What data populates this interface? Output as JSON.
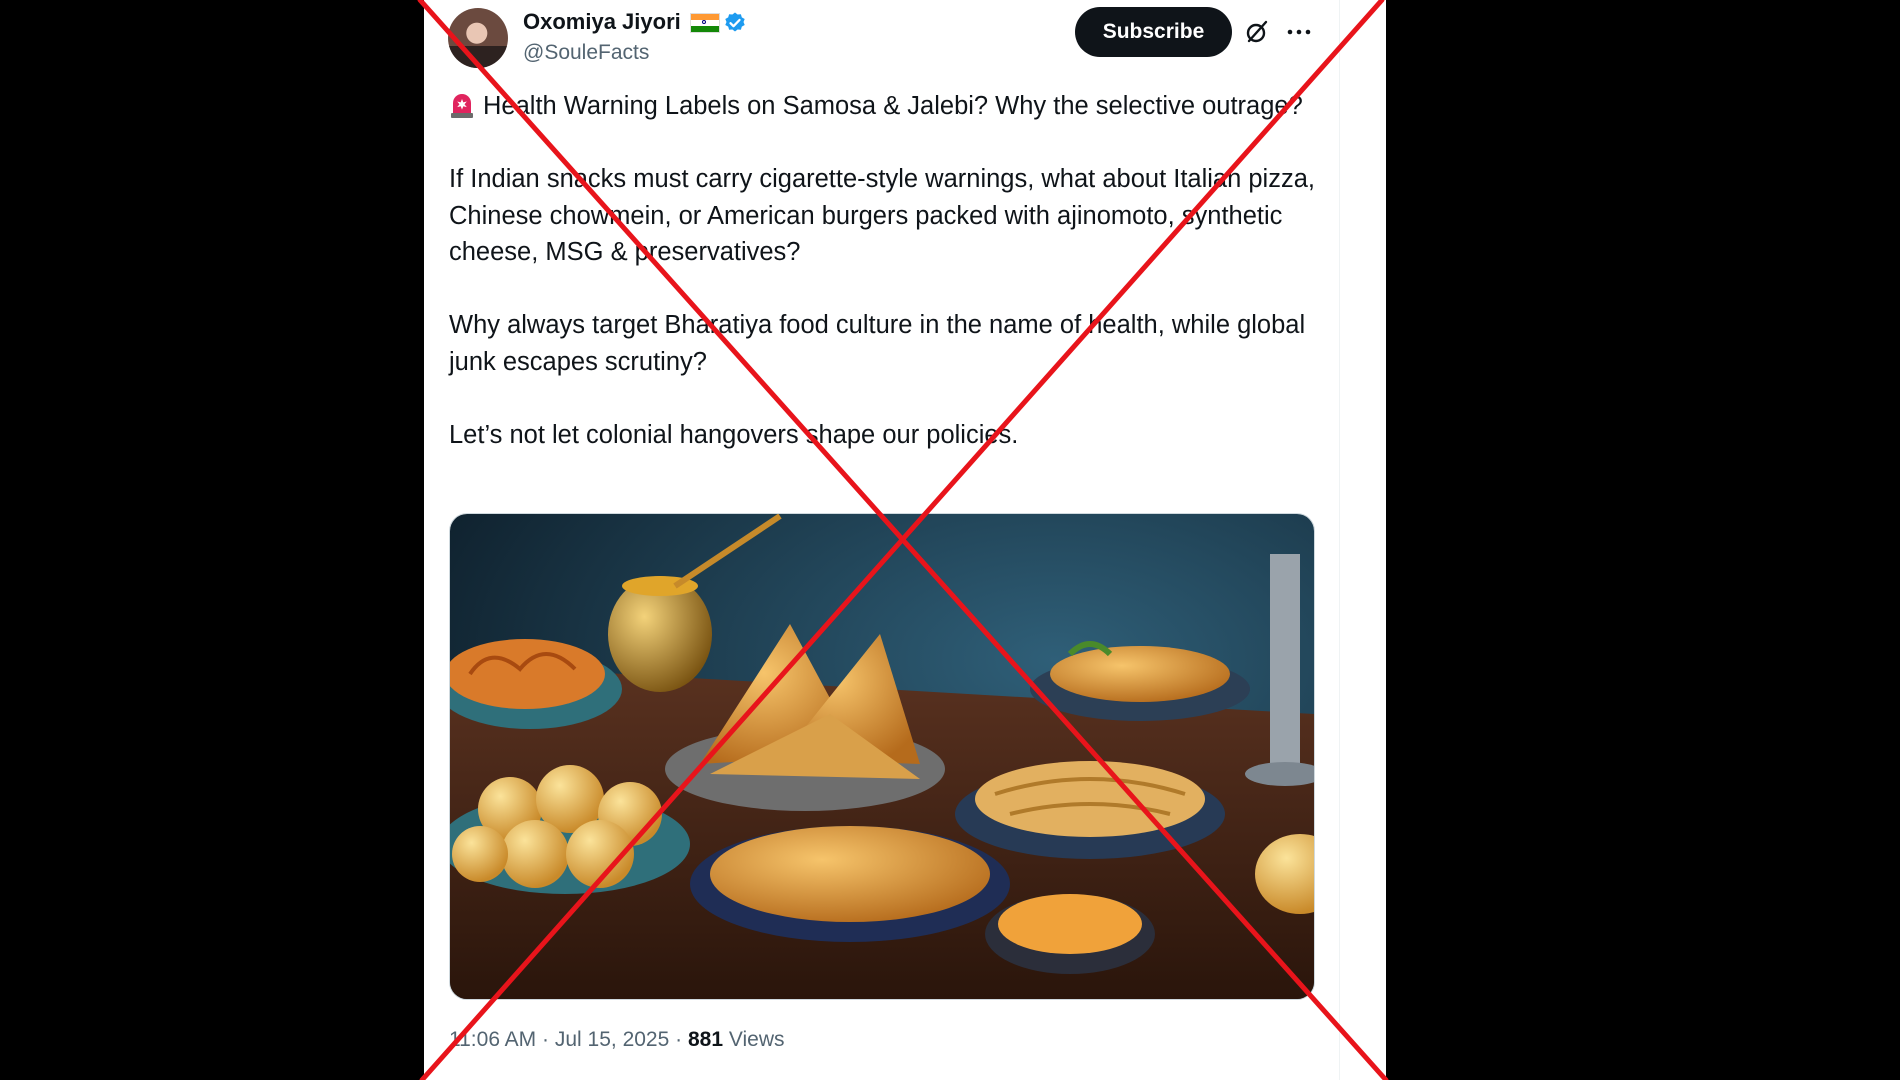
{
  "author": {
    "display_name": "Oxomiya Jiyori",
    "handle": "@SouleFacts",
    "avatar_icon": "user-avatar",
    "flag_icon": "india-flag-icon",
    "verified_icon": "verified-badge-icon",
    "verified_color": "#1d9bf0"
  },
  "header_actions": {
    "subscribe_label": "Subscribe",
    "grok_icon": "grok-icon",
    "more_icon": "more-icon"
  },
  "post": {
    "siren_icon": "siren-emoji",
    "paragraph_1": "Health Warning Labels on Samosa & Jalebi? Why the selective outrage?",
    "paragraph_2": "If Indian snacks must carry cigarette-style warnings, what about Italian pizza, Chinese chowmein, or American burgers packed with ajinomoto, synthetic cheese, MSG & preservatives?",
    "paragraph_3": "Why always target Bharatiya food culture in the name of health, while global junk escapes scrutiny?",
    "paragraph_4": "Let’s not let colonial hangovers shape our policies."
  },
  "media": {
    "subject": "indian-snacks-photo"
  },
  "meta": {
    "time": "11:06 AM",
    "separator": "·",
    "date": "Jul 15, 2025",
    "views_count": "881",
    "views_label": "Views"
  },
  "overlay": {
    "mark": "red-x-cross",
    "color": "#e8141b"
  },
  "colors": {
    "text_primary": "#0f1419",
    "text_secondary": "#536471",
    "button_bg": "#0f1419"
  }
}
